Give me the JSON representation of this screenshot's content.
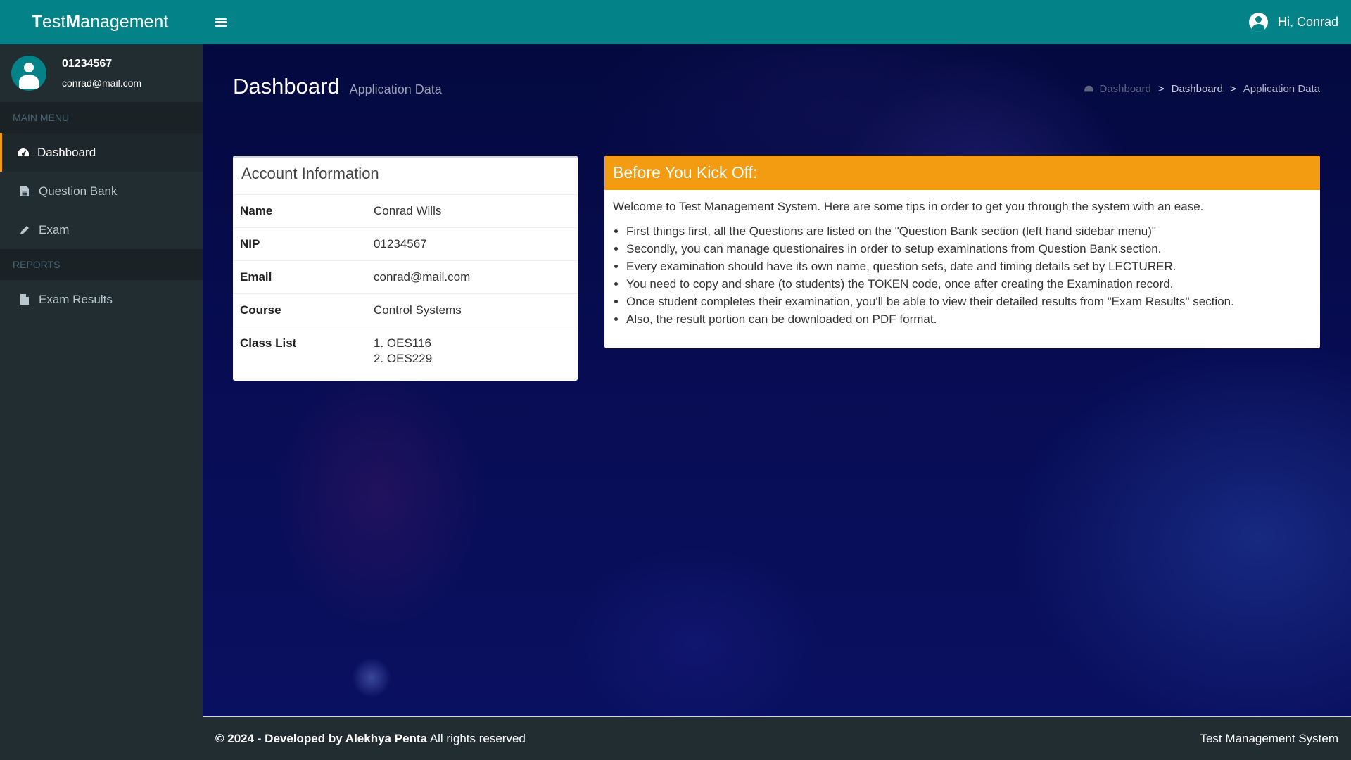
{
  "header": {
    "brand_part1": "T",
    "brand_part2": "est ",
    "brand_part3": "M",
    "brand_part4": "anagement",
    "greeting": "Hi, Conrad"
  },
  "sidebar": {
    "user_id": "01234567",
    "user_email": "conrad@mail.com",
    "main_menu_header": "MAIN MENU",
    "reports_header": "REPORTS",
    "items": [
      {
        "label": "Dashboard",
        "icon": "dashboard-icon"
      },
      {
        "label": "Question Bank",
        "icon": "file-text-icon"
      },
      {
        "label": "Exam",
        "icon": "pencil-icon"
      }
    ],
    "report_items": [
      {
        "label": "Exam Results",
        "icon": "file-icon"
      }
    ]
  },
  "page": {
    "title": "Dashboard",
    "subtitle": "Application Data",
    "breadcrumb": [
      "Dashboard",
      "Dashboard",
      "Application Data"
    ]
  },
  "account": {
    "title": "Account Information",
    "rows": [
      {
        "key": "Name",
        "value": "Conrad Wills"
      },
      {
        "key": "NIP",
        "value": "01234567"
      },
      {
        "key": "Email",
        "value": "conrad@mail.com"
      },
      {
        "key": "Course",
        "value": "Control Systems"
      }
    ],
    "class_list_label": "Class List",
    "class_list": [
      "1. OES116",
      "2. OES229"
    ]
  },
  "kickoff": {
    "title": "Before You Kick Off:",
    "intro": "Welcome to Test Management System. Here are some tips in order to get you through the system with an ease.",
    "tips": [
      "First things first, all the Questions are listed on the \"Question Bank section (left hand sidebar menu)\"",
      "Secondly, you can manage questionaires in order to setup examinations from Question Bank section.",
      "Every examination should have its own name, question sets, date and timing details set by LECTURER.",
      "You need to copy and share (to students) the TOKEN code, once after creating the Examination record.",
      "Once student completes their examination, you'll be able to view their detailed results from \"Exam Results\" section.",
      "Also, the result portion can be downloaded on PDF format."
    ]
  },
  "footer": {
    "copyright": "© 2024 - Developed by Alekhya Penta",
    "rights": " All rights reserved",
    "system_name": "Test Management System"
  },
  "colors": {
    "header_teal": "#038387",
    "sidebar_dark": "#222d32",
    "accent_orange": "#f39c12"
  }
}
